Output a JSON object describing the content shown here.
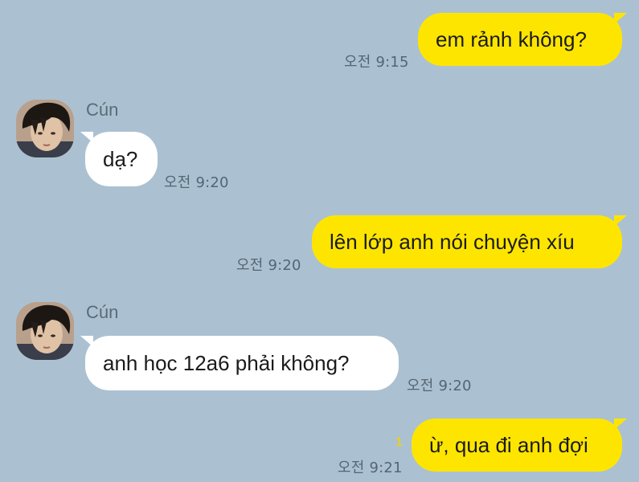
{
  "conversation": {
    "messages": [
      {
        "from": "me",
        "text": "em rảnh không?",
        "time": "오전 9:15"
      },
      {
        "from": "them",
        "sender": "Cún",
        "text": "dạ?",
        "time": "오전 9:20"
      },
      {
        "from": "me",
        "text": "lên lớp anh nói chuyện xíu",
        "time": "오전 9:20"
      },
      {
        "from": "them",
        "sender": "Cún",
        "text": "anh học 12a6 phải không?",
        "time": "오전 9:20"
      },
      {
        "from": "me",
        "text": "ừ, qua đi anh đợi",
        "time": "오전 9:21",
        "unread": "1"
      }
    ]
  },
  "theme": {
    "background": "#abc1d1",
    "my_bubble": "#fee500",
    "their_bubble": "#ffffff",
    "unread_color": "#e4cf2c"
  }
}
